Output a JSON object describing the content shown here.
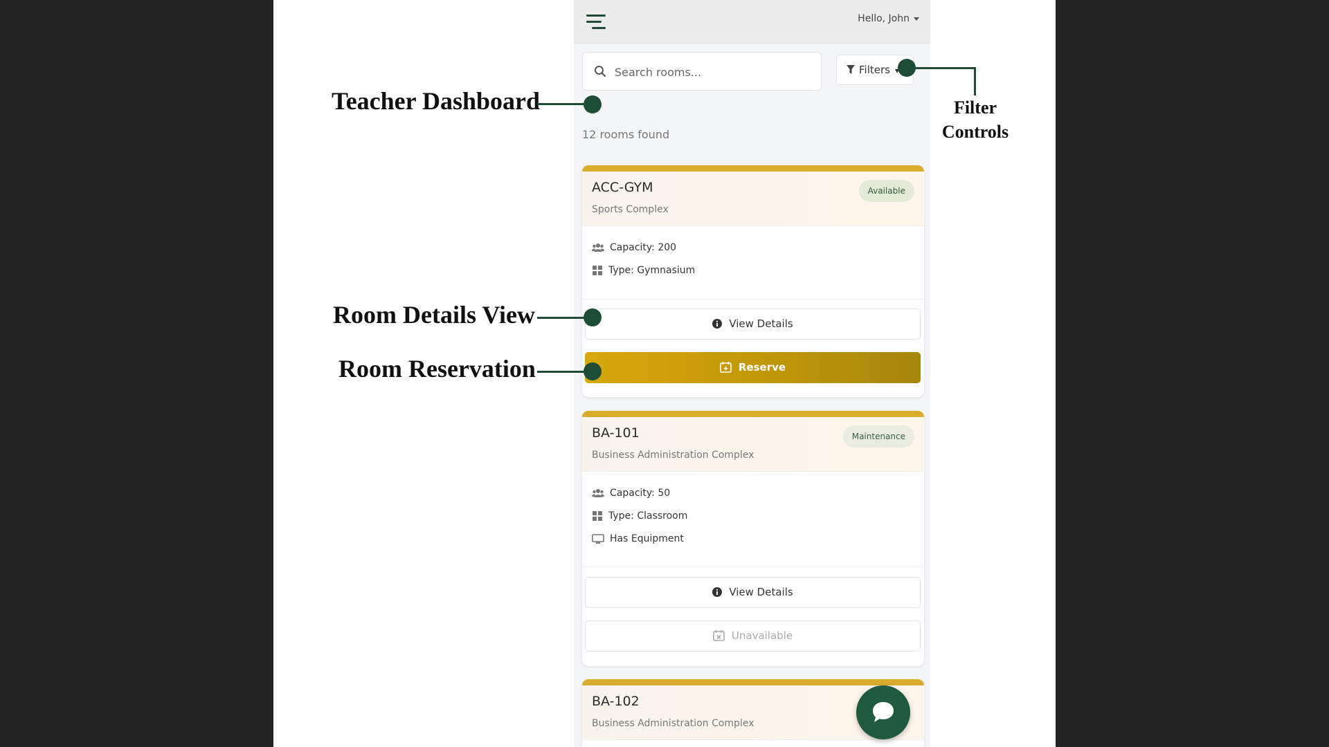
{
  "header": {
    "greeting": "Hello, John"
  },
  "search": {
    "placeholder": "Search rooms..."
  },
  "filters": {
    "label": "Filters"
  },
  "results": {
    "count_text": "12 rooms found"
  },
  "rooms": [
    {
      "code": "ACC-GYM",
      "building": "Sports Complex",
      "status": "Available",
      "capacity": "Capacity: 200",
      "type": "Type: Gymnasium",
      "view_label": "View Details",
      "action_label": "Reserve"
    },
    {
      "code": "BA-101",
      "building": "Business Administration Complex",
      "status": "Maintenance",
      "capacity": "Capacity: 50",
      "type": "Type: Classroom",
      "equipment": "Has Equipment",
      "view_label": "View Details",
      "action_label": "Unavailable"
    },
    {
      "code": "BA-102",
      "building": "Business Administration Complex"
    }
  ],
  "annotations": {
    "dashboard": "Teacher Dashboard",
    "details": "Room Details View",
    "reservation": "Room Reservation",
    "filter_line1": "Filter",
    "filter_line2": "Controls"
  },
  "colors": {
    "accent_green": "#1f5a3e",
    "gold_stripe": "#d9ad2b",
    "reserve_gold": "#c49a09"
  }
}
